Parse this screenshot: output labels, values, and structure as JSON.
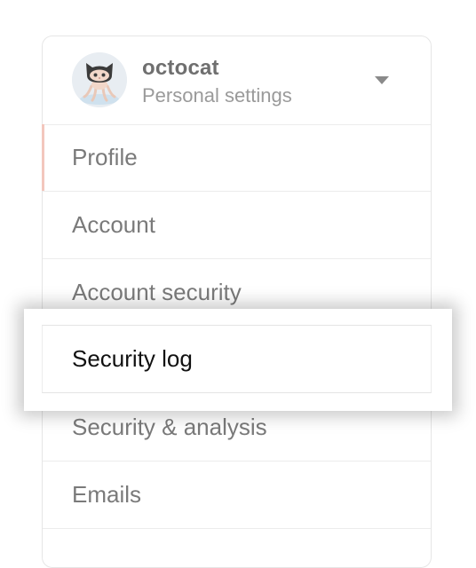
{
  "profile": {
    "username": "octocat",
    "subtitle": "Personal settings"
  },
  "menu": {
    "items": [
      {
        "label": "Profile"
      },
      {
        "label": "Account"
      },
      {
        "label": "Account security"
      },
      {
        "label": "Security log"
      },
      {
        "label": "Security & analysis"
      },
      {
        "label": "Emails"
      }
    ]
  },
  "icons": {
    "avatar": "octocat-avatar",
    "dropdown": "chevron-down-icon"
  },
  "colors": {
    "active_indicator": "#f3c7bd",
    "highlight_text": "#111111"
  }
}
